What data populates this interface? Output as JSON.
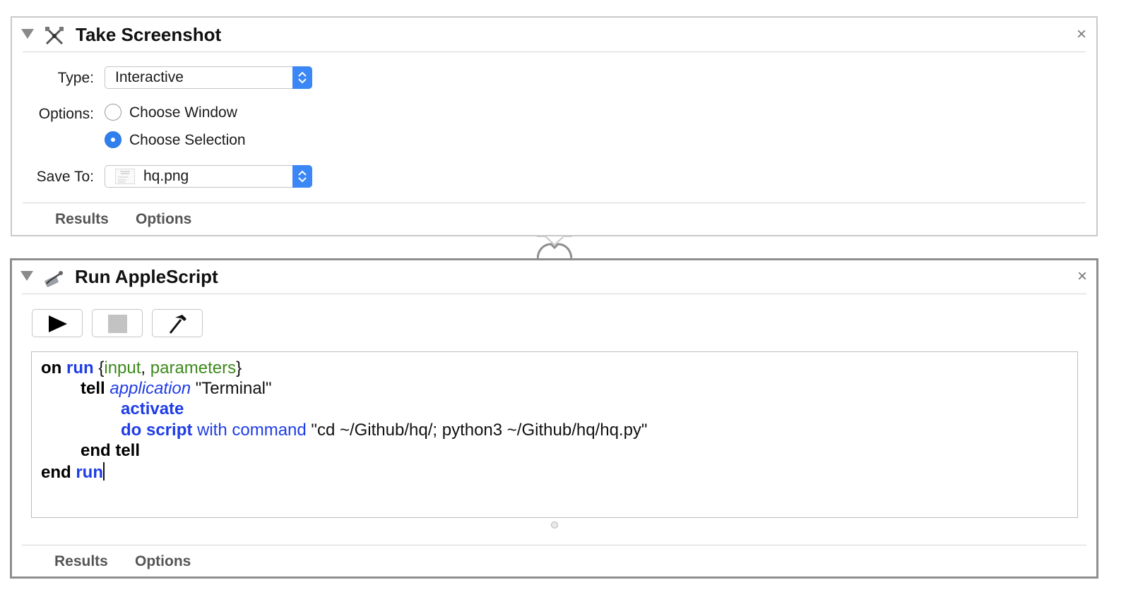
{
  "actions": [
    {
      "title": "Take Screenshot",
      "close_label": "×",
      "type_label": "Type:",
      "type_value": "Interactive",
      "options_label": "Options:",
      "option_choose_window": "Choose Window",
      "option_choose_selection": "Choose Selection",
      "selected_option": "Choose Selection",
      "save_to_label": "Save To:",
      "save_to_value": "hq.png",
      "tabs": [
        "Results",
        "Options"
      ]
    },
    {
      "title": "Run AppleScript",
      "close_label": "×",
      "tabs": [
        "Results",
        "Options"
      ],
      "script": {
        "l1": {
          "kw_on": "on",
          "kw_run": "run",
          "open": " {",
          "p_input": "input",
          "comma": ", ",
          "p_parameters": "parameters",
          "close": "}"
        },
        "l2": {
          "kw_tell": "tell",
          "app": "application",
          "str": "\"Terminal\""
        },
        "l3": {
          "kw_activate": "activate"
        },
        "l4": {
          "kw_do_script": "do script",
          "cmd": "with command",
          "str": "\"cd ~/Github/hq/; python3 ~/Github/hq/hq.py\""
        },
        "l5": {
          "kw_end_tell": "end tell"
        },
        "l6": {
          "kw_end": "end",
          "kw_run": "run"
        }
      }
    }
  ],
  "colors": {
    "accent": "#3a87f5",
    "keyword_blue": "#1f3de6",
    "variable_green": "#3e8a1c"
  }
}
